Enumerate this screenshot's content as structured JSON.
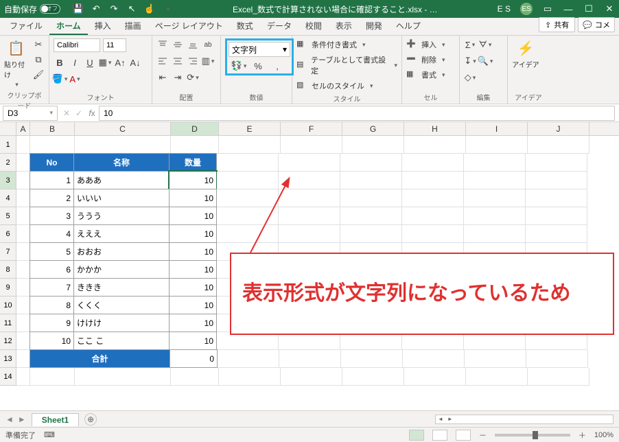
{
  "titlebar": {
    "autosave_label": "自動保存",
    "autosave_state": "オフ",
    "filename": "Excel_数式で計算されない場合に確認すること.xlsx - …",
    "user_initials": "ES",
    "user_tag": "E S"
  },
  "tabs": {
    "items": [
      "ファイル",
      "ホーム",
      "挿入",
      "描画",
      "ページ レイアウト",
      "数式",
      "データ",
      "校閲",
      "表示",
      "開発",
      "ヘルプ"
    ],
    "active_index": 1,
    "share_label": "共有",
    "comment_label": "コメ"
  },
  "ribbon": {
    "clipboard": {
      "paste_label": "貼り付け",
      "group_label": "クリップボード"
    },
    "font": {
      "name": "Calibri",
      "size": "11",
      "group_label": "フォント",
      "bold": "B",
      "italic": "I",
      "underline": "U"
    },
    "alignment": {
      "group_label": "配置",
      "wrap": "ab"
    },
    "number": {
      "group_label": "数値",
      "format_value": "文字列",
      "percent": "%",
      "comma": ","
    },
    "styles": {
      "group_label": "スタイル",
      "cond": "条件付き書式",
      "table": "テーブルとして書式設定",
      "cell": "セルのスタイル"
    },
    "cells": {
      "group_label": "セル",
      "insert": "挿入",
      "delete": "削除",
      "format": "書式"
    },
    "editing": {
      "group_label": "編集",
      "sum": "Σ"
    },
    "ideas": {
      "label": "アイデア",
      "group_label": "アイデア"
    }
  },
  "fx": {
    "name_box": "D3",
    "value": "10"
  },
  "grid": {
    "columns": [
      "A",
      "B",
      "C",
      "D",
      "E",
      "F",
      "G",
      "H",
      "I",
      "J"
    ],
    "headers": {
      "no": "No",
      "name": "名称",
      "qty": "数量"
    },
    "rows": [
      {
        "no": 1,
        "name": "あああ",
        "qty": 10
      },
      {
        "no": 2,
        "name": "いいい",
        "qty": 10
      },
      {
        "no": 3,
        "name": "ううう",
        "qty": 10
      },
      {
        "no": 4,
        "name": "えええ",
        "qty": 10
      },
      {
        "no": 5,
        "name": "おおお",
        "qty": 10
      },
      {
        "no": 6,
        "name": "かかか",
        "qty": 10
      },
      {
        "no": 7,
        "name": "ききき",
        "qty": 10
      },
      {
        "no": 8,
        "name": "くくく",
        "qty": 10
      },
      {
        "no": 9,
        "name": "けけけ",
        "qty": 10
      },
      {
        "no": 10,
        "name": "ここ こ",
        "qty": 10
      }
    ],
    "total_label": "合計",
    "total_value": 0,
    "row_numbers": [
      1,
      2,
      3,
      4,
      5,
      6,
      7,
      8,
      9,
      10,
      11,
      12,
      13,
      14
    ],
    "selected_cell": "D3"
  },
  "callout": {
    "text": "表示形式が文字列になっているため"
  },
  "sheet": {
    "name": "Sheet1"
  },
  "status": {
    "ready": "準備完了",
    "scroll_lock": "🐭",
    "zoom": "100%",
    "minus": "－",
    "plus": "＋"
  }
}
